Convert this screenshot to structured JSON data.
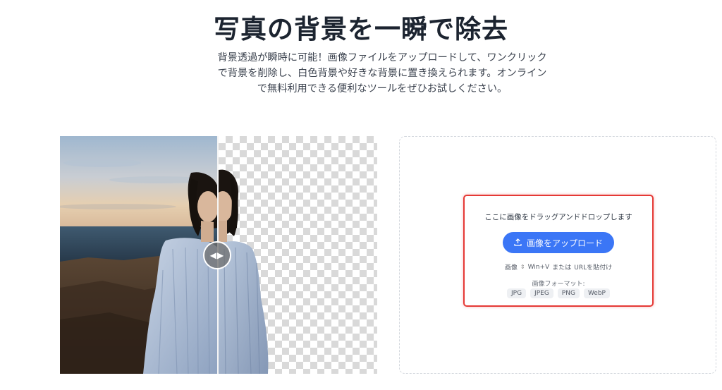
{
  "header": {
    "title": "写真の背景を一瞬で除去",
    "description_lines": [
      "背景透過が瞬時に可能！画像ファイルをアップロードして、ワンクリック",
      "で背景を削除し、白色背景や好きな背景に置き換えられます。オンライン",
      "で無料利用できる便利なツールをぜひお試しください。"
    ]
  },
  "compare": {
    "handle_glyph": "◀▶",
    "divider_position": 0.5
  },
  "upload": {
    "drop_text": "ここに画像をドラッグアンドドロップします",
    "button_label": "画像をアップロード",
    "button_icon": "upload-icon",
    "paste_prefix": "画像",
    "paste_shortcut": "Win+V",
    "paste_middle": "または",
    "paste_suffix": "URLを貼付け",
    "formats_label": "画像フォーマット:",
    "formats": [
      "JPG",
      "JPEG",
      "PNG",
      "WebP"
    ]
  },
  "colors": {
    "accent": "#3b76f6",
    "highlight_border": "#e53935"
  }
}
